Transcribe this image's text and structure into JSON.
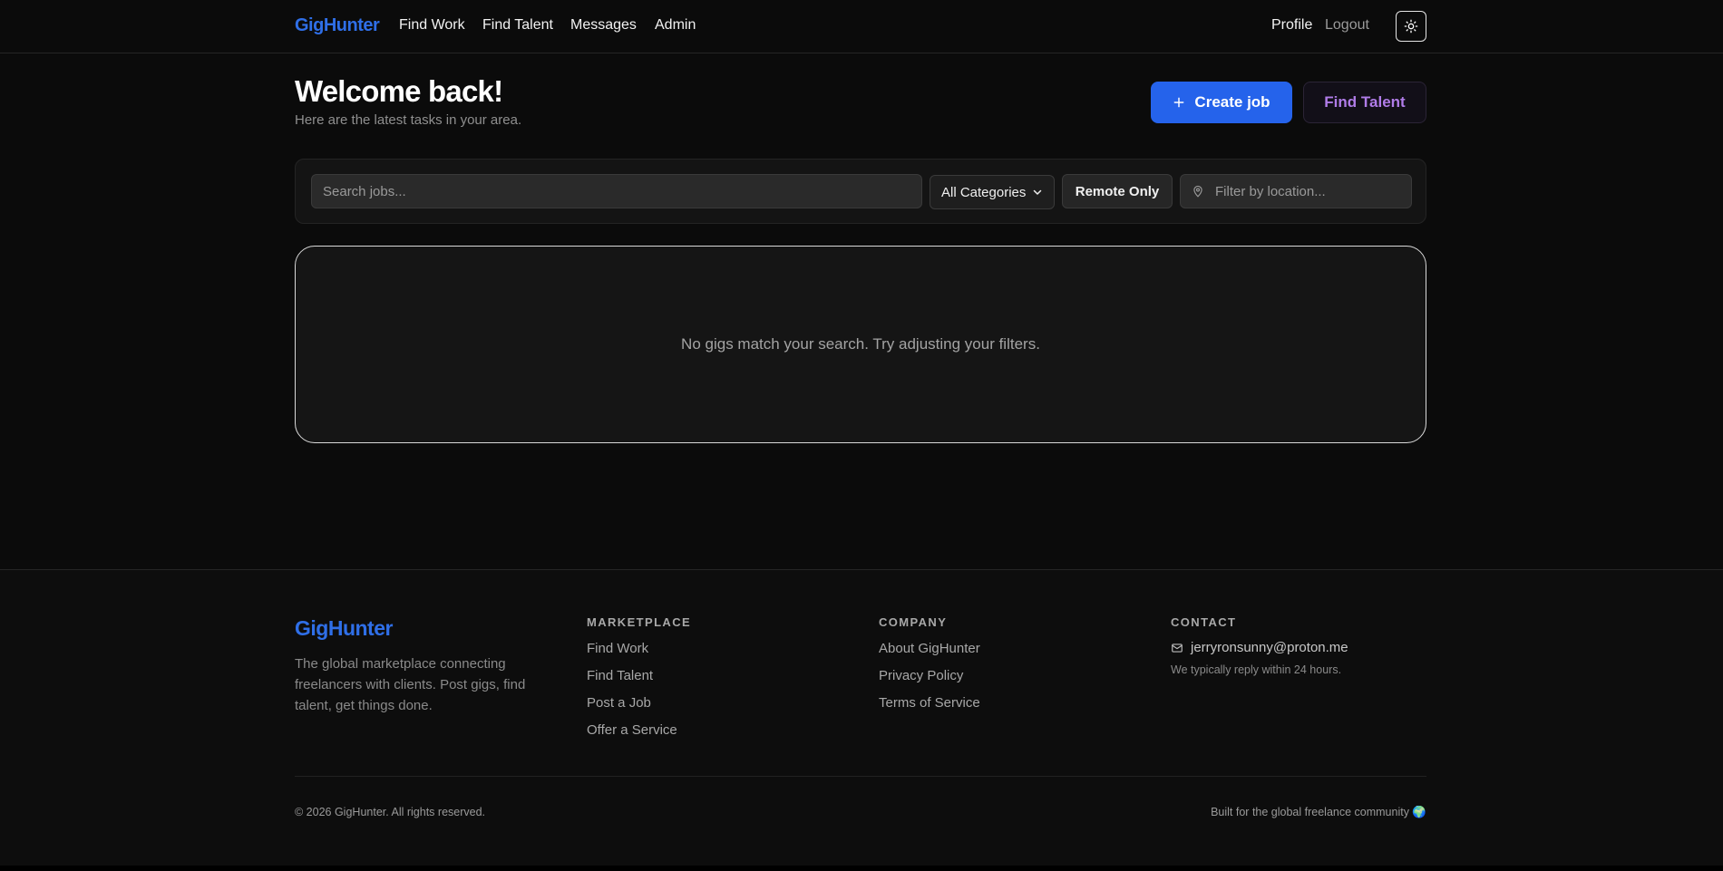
{
  "header": {
    "brand": "GigHunter",
    "nav": [
      "Find Work",
      "Find Talent",
      "Messages",
      "Admin"
    ],
    "profile": "Profile",
    "logout": "Logout",
    "theme_icon": "sun-icon"
  },
  "hero": {
    "title": "Welcome back!",
    "subtitle": "Here are the latest tasks in your area.",
    "create_label": "Create job",
    "talent_label": "Find Talent"
  },
  "filters": {
    "search_placeholder": "Search jobs...",
    "category_value": "All Categories",
    "remote_label": "Remote Only",
    "location_placeholder": "Filter by location..."
  },
  "empty_state": {
    "message": "No gigs match your search. Try adjusting your filters."
  },
  "footer": {
    "brand": "GigHunter",
    "description": "The global marketplace connecting freelancers with clients. Post gigs, find talent, get things done.",
    "marketplace": {
      "title": "MARKETPLACE",
      "links": [
        "Find Work",
        "Find Talent",
        "Post a Job",
        "Offer a Service"
      ]
    },
    "company": {
      "title": "COMPANY",
      "links": [
        "About GigHunter",
        "Privacy Policy",
        "Terms of Service"
      ]
    },
    "contact": {
      "title": "CONTACT",
      "email": "jerryronsunny@proton.me",
      "reply_note": "We typically reply within 24 hours."
    },
    "copyright": "© 2026 GigHunter. All rights reserved.",
    "built_for": "Built for the global freelance community 🌍"
  },
  "colors": {
    "accent": "#2563eb",
    "brand": "#2f6fe8",
    "talent_text": "#b07ce8",
    "background": "#0b0b0b"
  }
}
